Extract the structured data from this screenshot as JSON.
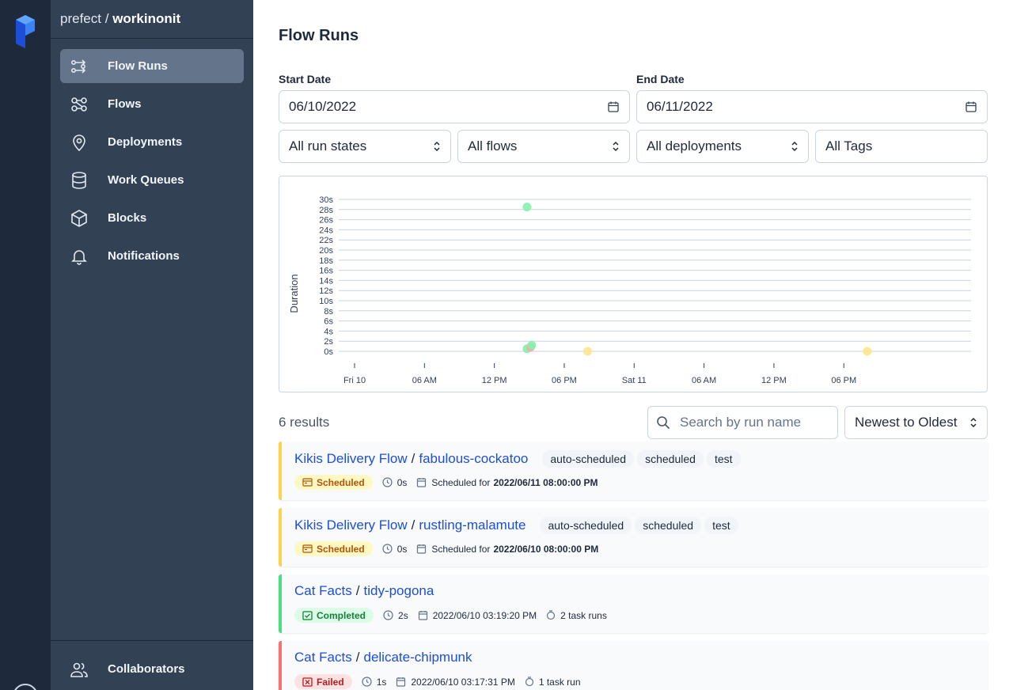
{
  "workspace": {
    "account": "prefect",
    "separator": "/",
    "name": "workinonit"
  },
  "nav": {
    "items": [
      {
        "label": "Flow Runs",
        "icon": "flow-runs-icon",
        "active": true
      },
      {
        "label": "Flows",
        "icon": "flows-icon"
      },
      {
        "label": "Deployments",
        "icon": "map-pin-icon"
      },
      {
        "label": "Work Queues",
        "icon": "database-icon"
      },
      {
        "label": "Blocks",
        "icon": "cube-icon"
      },
      {
        "label": "Notifications",
        "icon": "bell-icon"
      }
    ],
    "footer": {
      "label": "Collaborators",
      "icon": "users-icon"
    }
  },
  "page": {
    "title": "Flow Runs"
  },
  "filters": {
    "start_date_label": "Start Date",
    "start_date": "06/10/2022",
    "end_date_label": "End Date",
    "end_date": "06/11/2022",
    "states": "All run states",
    "flows": "All flows",
    "deployments": "All deployments",
    "tags": "All Tags"
  },
  "chart_data": {
    "type": "scatter",
    "ylabel": "Duration",
    "y_unit": "s",
    "y_ticks": [
      "0s",
      "2s",
      "4s",
      "6s",
      "8s",
      "10s",
      "12s",
      "14s",
      "16s",
      "18s",
      "20s",
      "22s",
      "24s",
      "26s",
      "28s",
      "30s"
    ],
    "ylim": [
      0,
      30
    ],
    "x_ticks": [
      "Fri 10",
      "06 AM",
      "12 PM",
      "06 PM",
      "Sat 11",
      "06 AM",
      "12 PM",
      "06 PM"
    ],
    "x_tick_hours": [
      0,
      6,
      12,
      18,
      24,
      30,
      36,
      42
    ],
    "grid": true,
    "points": [
      {
        "hour": 14.8,
        "duration": 28.5,
        "state": "Completed",
        "color": "#86efac"
      },
      {
        "hour": 14.8,
        "duration": 0.5,
        "state": "Completed",
        "color": "#86efac"
      },
      {
        "hour": 15.1,
        "duration": 0.8,
        "state": "Failed",
        "color": "#fca5a5"
      },
      {
        "hour": 15.2,
        "duration": 1.2,
        "state": "Completed",
        "color": "#86efac"
      },
      {
        "hour": 20.0,
        "duration": 0,
        "state": "Scheduled",
        "color": "#fde68a"
      },
      {
        "hour": 44.0,
        "duration": 0,
        "state": "Scheduled",
        "color": "#fde68a"
      }
    ]
  },
  "results": {
    "count_text": "6 results",
    "search_placeholder": "Search by run name",
    "sort": "Newest to Oldest"
  },
  "runs": [
    {
      "flow": "Kikis Delivery Flow",
      "name": "fabulous-cockatoo",
      "tags": [
        "auto-scheduled",
        "scheduled",
        "test"
      ],
      "state": "Scheduled",
      "duration": "0s",
      "date_prefix": "Scheduled for",
      "date": "2022/06/11 08:00:00 PM",
      "task_runs": ""
    },
    {
      "flow": "Kikis Delivery Flow",
      "name": "rustling-malamute",
      "tags": [
        "auto-scheduled",
        "scheduled",
        "test"
      ],
      "state": "Scheduled",
      "duration": "0s",
      "date_prefix": "Scheduled for",
      "date": "2022/06/10 08:00:00 PM",
      "task_runs": ""
    },
    {
      "flow": "Cat Facts",
      "name": "tidy-pogona",
      "tags": [],
      "state": "Completed",
      "duration": "2s",
      "date_prefix": "",
      "date": "2022/06/10 03:19:20 PM",
      "task_runs": "2 task runs"
    },
    {
      "flow": "Cat Facts",
      "name": "delicate-chipmunk",
      "tags": [],
      "state": "Failed",
      "duration": "1s",
      "date_prefix": "",
      "date": "2022/06/10 03:17:31 PM",
      "task_runs": "1 task run"
    }
  ],
  "colors": {
    "accent_link": "#1d4ed8",
    "scheduled": "#fcd34d",
    "completed": "#4ade80",
    "failed": "#f87171",
    "sidebar": "#334155",
    "rail": "#1e293b"
  }
}
